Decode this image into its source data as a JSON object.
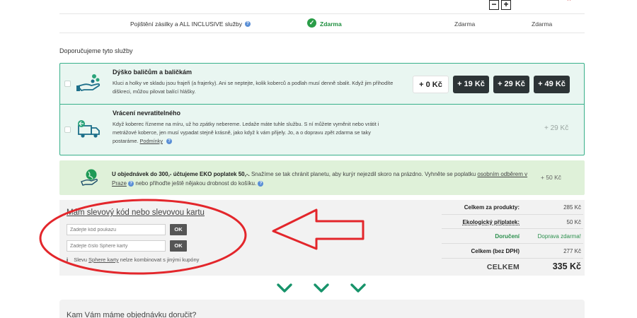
{
  "top_row": {
    "minus_label": "−",
    "plus_label": "+",
    "remove_label": "×"
  },
  "insurance": {
    "label": "Pojištění zásilky a ALL INCLUSIVE služby",
    "help": "?",
    "check": "✓",
    "selected_value": "Zdarma",
    "col2_value": "Zdarma",
    "col3_value": "Zdarma"
  },
  "recommended": {
    "title": "Doporučujeme tyto služby",
    "services": [
      {
        "title": "Dýško baličům a baličkám",
        "icon": "hand-coins-icon",
        "description": "Kluci a holky ve skladu jsou frajeři (a frajerky). Ani se neptejte, kolik koberců a podlah musí denně sbalit. Když jim přihodíte diškreci, můžou pilovat balící hlášky.",
        "prices": [
          "+ 0 Kč",
          "+ 19 Kč",
          "+ 29 Kč",
          "+ 49 Kč"
        ]
      },
      {
        "title": "Vrácení nevratitelného",
        "icon": "return-truck-icon",
        "description": "Když koberec řízneme na míru, už ho zpátky nebereme. Ledaže máte tuhle službu. S ní můžete vyměnit nebo vrátit i metrážové koberce, jen musí vypadat stejně krásně, jako když k vám přijely. Jo, a o dopravu zpět zdarma se taky postaráme.",
        "terms_link": "Podmínky",
        "help": "?",
        "price": "+ 29 Kč"
      }
    ]
  },
  "eco": {
    "icon": "eco-globe-hand-icon",
    "strong": "U objednávek do 300,- účtujeme EKO poplatek 50,-.",
    "text1": "Snažíme se tak chránit planetu, aby kurýr nejezdil skoro na prázdno. Vyhněte se poplatku",
    "link": "osobním odběrem v Praze",
    "text2": "nebo přihoďte ještě nějakou drobnost do košíku.",
    "help": "?",
    "price": "+ 50 Kč"
  },
  "coupon": {
    "title": "Mám slevový kód nebo slevovou kartu",
    "code_placeholder": "Zadejte kód poukazu",
    "card_placeholder": "Zadejte číslo Sphere karty",
    "ok_label": "OK",
    "note_icon": "i",
    "note_pre": "Slevu",
    "note_link": "Sphere karty",
    "note_post": "nelze kombinovat s jinými kupóny"
  },
  "summary": {
    "rows": [
      {
        "label": "Celkem za produkty:",
        "value": "285 Kč"
      },
      {
        "label": "Ekologický příplatek:",
        "value": "50 Kč"
      },
      {
        "label": "Doručení",
        "value": "Doprava zdarma!"
      },
      {
        "label": "Celkem (bez DPH)",
        "value": "277 Kč"
      }
    ],
    "total_label": "CELKEM",
    "total_value": "335 Kč"
  },
  "delivery": {
    "title": "Kam Vám máme objednávku doručit?"
  },
  "colors": {
    "accent_green": "#2a9d48",
    "service_border": "#38b08a",
    "annotation_red": "#e3262b",
    "dark_button": "#2d3436"
  }
}
